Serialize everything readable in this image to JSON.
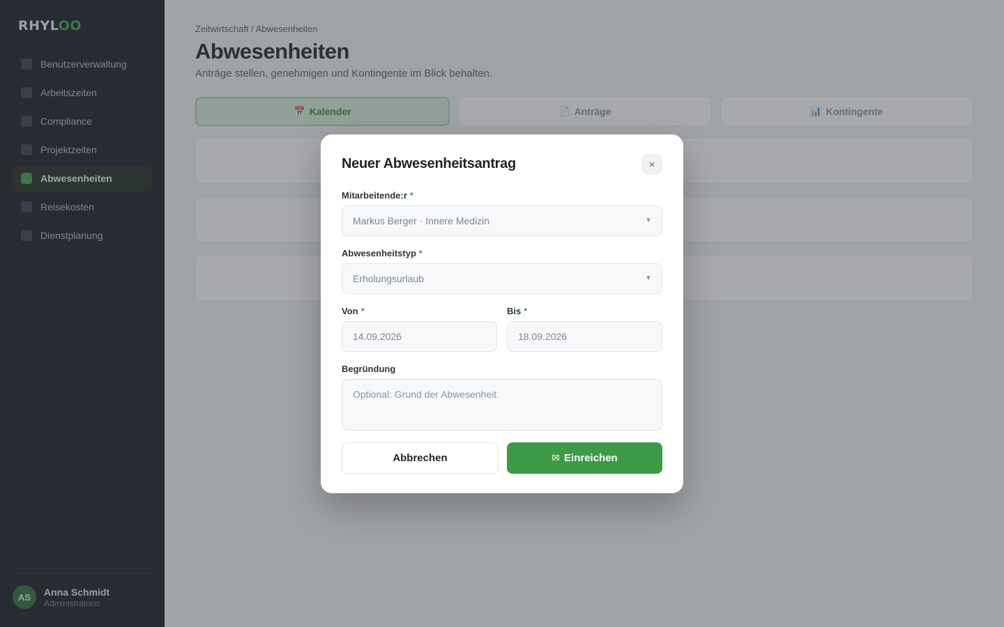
{
  "app": {
    "logo_main": "RHYL",
    "logo_accent": "OO",
    "accent_color": "#3fa34d"
  },
  "sidebar": {
    "items": [
      {
        "label": "Benutzerverwaltung",
        "active": false
      },
      {
        "label": "Arbeitszeiten",
        "active": false
      },
      {
        "label": "Compliance",
        "active": false
      },
      {
        "label": "Projektzeiten",
        "active": false
      },
      {
        "label": "Abwesenheiten",
        "active": true
      },
      {
        "label": "Reisekosten",
        "active": false
      },
      {
        "label": "Dienstplanung",
        "active": false
      }
    ],
    "user": {
      "initials": "AS",
      "name": "Anna Schmidt",
      "role": "Administratorin"
    }
  },
  "main": {
    "breadcrumb": "Zeitwirtschaft / Abwesenheiten",
    "title": "Abwesenheiten",
    "subtitle": "Anträge stellen, genehmigen und Kontingente im Blick behalten.",
    "tabs": [
      {
        "icon": "📅",
        "icon_name": "calendar-icon",
        "label": "Kalender",
        "active": true
      },
      {
        "icon": "📄",
        "icon_name": "document-icon",
        "label": "Anträge",
        "active": false
      },
      {
        "icon": "📊",
        "icon_name": "bar-chart-icon",
        "label": "Kontingente",
        "active": false
      }
    ]
  },
  "modal": {
    "title": "Neuer Abwesenheitsantrag",
    "close_symbol": "×",
    "required_marker": "*",
    "employee": {
      "label": "Mitarbeitende:r",
      "value": "Markus Berger · Innere Medizin"
    },
    "type": {
      "label": "Abwesenheitstyp",
      "value": "Erholungsurlaub"
    },
    "from": {
      "label": "Von",
      "value": "14.09.2026"
    },
    "to": {
      "label": "Bis",
      "value": "18.09.2026"
    },
    "reason": {
      "label": "Begründung",
      "placeholder": "Optional: Grund der Abwesenheit"
    },
    "cancel_label": "Abbrechen",
    "submit_icon": "✉",
    "submit_label": "Einreichen"
  }
}
